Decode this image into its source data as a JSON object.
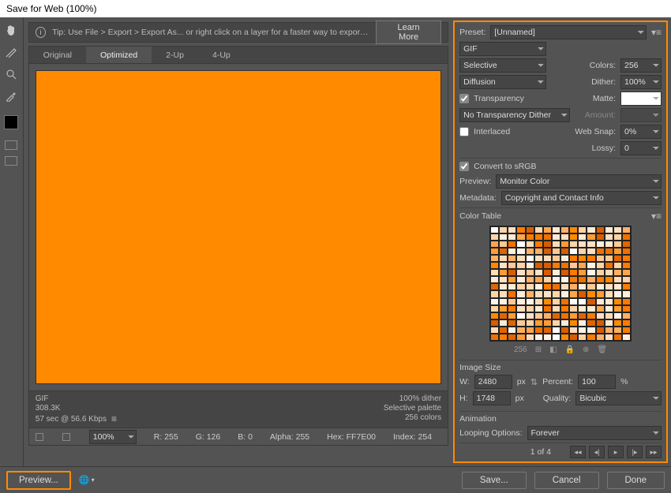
{
  "window": {
    "title": "Save for Web (100%)"
  },
  "tip": {
    "text": "Tip: Use File > Export > Export As... or right click on a layer for a faster way to export assets",
    "learn_more": "Learn More"
  },
  "tabs": {
    "original": "Original",
    "optimized": "Optimized",
    "two_up": "2-Up",
    "four_up": "4-Up"
  },
  "preview_info": {
    "format": "GIF",
    "size": "308.3K",
    "time": "57 sec @ 56.6 Kbps",
    "dither": "100% dither",
    "palette": "Selective palette",
    "colors": "256 colors"
  },
  "readout": {
    "zoom": "100%",
    "r": "R: 255",
    "g": "G: 126",
    "b": "B: 0",
    "alpha": "Alpha: 255",
    "hex": "Hex: FF7E00",
    "index": "Index: 254"
  },
  "bottom": {
    "preview": "Preview...",
    "save": "Save...",
    "cancel": "Cancel",
    "done": "Done"
  },
  "panel": {
    "preset_label": "Preset:",
    "preset_value": "[Unnamed]",
    "format": "GIF",
    "reduction": "Selective",
    "colors_label": "Colors:",
    "colors_value": "256",
    "dither_method": "Diffusion",
    "dither_label": "Dither:",
    "dither_value": "100%",
    "transparency": "Transparency",
    "matte_label": "Matte:",
    "trans_dither": "No Transparency Dither",
    "amount_label": "Amount:",
    "interlaced": "Interlaced",
    "websnap_label": "Web Snap:",
    "websnap_value": "0%",
    "lossy_label": "Lossy:",
    "lossy_value": "0",
    "srgb": "Convert to sRGB",
    "preview_label": "Preview:",
    "preview_value": "Monitor Color",
    "metadata_label": "Metadata:",
    "metadata_value": "Copyright and Contact Info",
    "color_table_label": "Color Table",
    "ct_count": "256",
    "image_size_label": "Image Size",
    "w_label": "W:",
    "w_value": "2480",
    "px": "px",
    "h_label": "H:",
    "h_value": "1748",
    "percent_label": "Percent:",
    "percent_value": "100",
    "percent_unit": "%",
    "quality_label": "Quality:",
    "quality_value": "Bicubic",
    "animation_label": "Animation",
    "looping_label": "Looping Options:",
    "looping_value": "Forever",
    "frame": "1 of 4"
  },
  "swatches": [
    "#ff8a00",
    "#ffb066",
    "#ffdcb8",
    "#fff4e8",
    "#ffffff",
    "#ff7a00",
    "#ffc894",
    "#e06500",
    "#ffead3",
    "#ff9c33",
    "#ffd3a6",
    "#fff0dd",
    "#ffa64d",
    "#f07000",
    "#ffe0c2",
    "#d85c00"
  ]
}
